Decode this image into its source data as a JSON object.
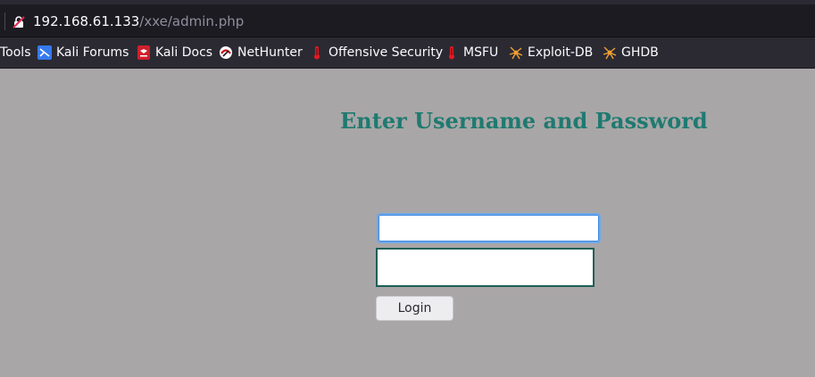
{
  "browser": {
    "url_host": "192.168.61.133",
    "url_path": "/xxe/admin.php",
    "security_icon": "insecure-lock-icon"
  },
  "bookmarks": [
    {
      "label": "Tools",
      "icon": ""
    },
    {
      "label": "Kali Forums",
      "icon": "kali-forums-icon"
    },
    {
      "label": "Kali Docs",
      "icon": "kali-docs-icon"
    },
    {
      "label": "NetHunter",
      "icon": "nethunter-icon"
    },
    {
      "label": "Offensive Security",
      "icon": "offsec-icon"
    },
    {
      "label": "MSFU",
      "icon": "msfu-icon"
    },
    {
      "label": "Exploit-DB",
      "icon": "exploit-db-icon"
    },
    {
      "label": "GHDB",
      "icon": "ghdb-icon"
    }
  ],
  "page": {
    "heading": "Enter Username and Password",
    "username_value": "",
    "password_value": "",
    "login_label": "Login"
  },
  "colors": {
    "page_background": "#a9a6a7",
    "heading": "#1f7a70",
    "browser_chrome": "#2b2a33"
  }
}
